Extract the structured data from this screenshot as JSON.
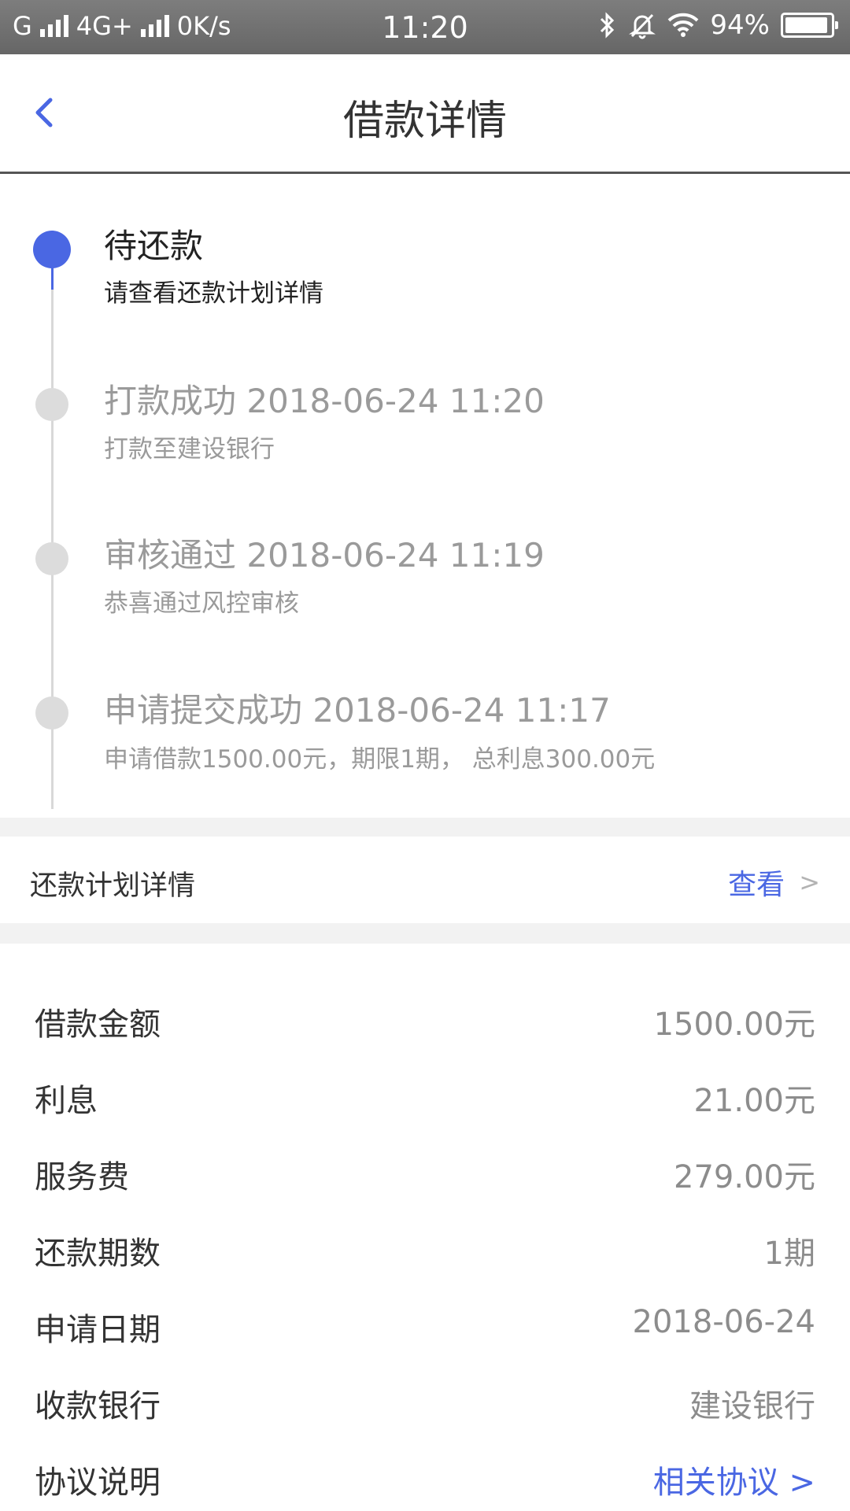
{
  "status_bar": {
    "carrier1": "G",
    "carrier2": "4G+",
    "speed": "0K/s",
    "time": "11:20",
    "battery": "94%",
    "battery_level": 0.94,
    "icons": [
      "signal-icon",
      "bluetooth-icon",
      "bell-muted-icon",
      "wifi-icon",
      "battery-icon"
    ]
  },
  "nav": {
    "title": "借款详情",
    "back_icon": "chevron-left-icon"
  },
  "timeline": [
    {
      "title": "待还款",
      "sub": "请查看还款计划详情",
      "state": "active"
    },
    {
      "title": "打款成功 2018-06-24 11:20",
      "sub": "打款至建设银行",
      "state": "done"
    },
    {
      "title": "审核通过 2018-06-24 11:19",
      "sub": "恭喜通过风控审核",
      "state": "done"
    },
    {
      "title": "申请提交成功 2018-06-24 11:17",
      "sub": "申请借款1500.00元，期限1期， 总利息300.00元",
      "state": "done"
    }
  ],
  "repayment_plan": {
    "label": "还款计划详情",
    "link": "查看",
    "chevron": ">"
  },
  "details": [
    {
      "label": "借款金额",
      "value": "1500.00元"
    },
    {
      "label": "利息",
      "value": "21.00元"
    },
    {
      "label": "服务费",
      "value": "279.00元"
    },
    {
      "label": "还款期数",
      "value": "1期"
    },
    {
      "label": "申请日期",
      "value": "2018-06-24"
    },
    {
      "label": "收款银行",
      "value": "建设银行"
    },
    {
      "label": "协议说明",
      "value": "相关协议 >"
    }
  ],
  "colors": {
    "accent": "#4a67e3",
    "grey_text": "#9a9a9a",
    "divider": "#f2f2f2"
  }
}
